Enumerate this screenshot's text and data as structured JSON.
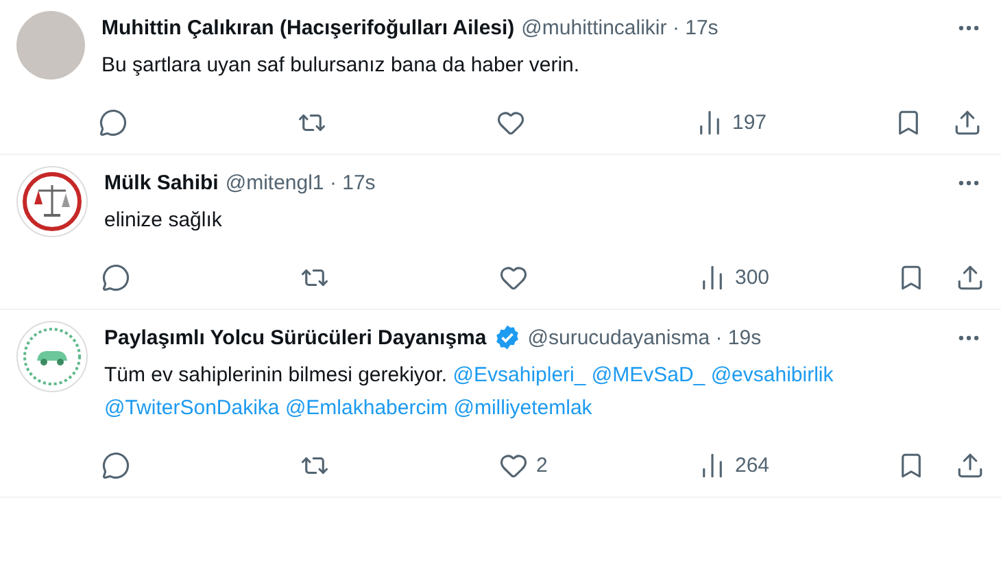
{
  "tweets": [
    {
      "author": {
        "name": "Muhittin Çalıkıran (Hacışerifoğulları Ailesi)",
        "handle": "@muhittincalikir",
        "verified": false,
        "avatar": {
          "kind": "photo"
        }
      },
      "separator": "·",
      "time": "17s",
      "body": [
        {
          "kind": "text",
          "text": "Bu şartlara uyan saf bulursanız bana da haber verin."
        }
      ],
      "actions": [
        {
          "kind": "reply"
        },
        {
          "kind": "retweet"
        },
        {
          "kind": "like"
        },
        {
          "kind": "views",
          "count": "197"
        },
        {
          "kind": "bookmark"
        },
        {
          "kind": "share"
        }
      ]
    },
    {
      "author": {
        "name": "Mülk Sahibi",
        "handle": "@mitengl1",
        "verified": false,
        "avatar": {
          "kind": "scale"
        }
      },
      "separator": "·",
      "time": "17s",
      "body": [
        {
          "kind": "text",
          "text": "elinize sağlık"
        }
      ],
      "actions": [
        {
          "kind": "reply"
        },
        {
          "kind": "retweet"
        },
        {
          "kind": "like"
        },
        {
          "kind": "views",
          "count": "300"
        },
        {
          "kind": "bookmark"
        },
        {
          "kind": "share"
        }
      ]
    },
    {
      "author": {
        "name": "Paylaşımlı Yolcu Sürücüleri Dayanışma",
        "handle": "@surucudayanisma",
        "verified": true,
        "avatar": {
          "kind": "car"
        }
      },
      "separator": "·",
      "time": "19s",
      "body": [
        {
          "kind": "text",
          "text": "Tüm ev sahiplerinin bilmesi gerekiyor."
        },
        {
          "kind": "mention",
          "text": "@Evsahipleri_"
        },
        {
          "kind": "mention",
          "text": "@MEvSaD_"
        },
        {
          "kind": "mention",
          "text": "@evsahibirlik"
        },
        {
          "kind": "mention",
          "text": "@TwiterSonDakika"
        },
        {
          "kind": "mention",
          "text": "@Emlakhabercim"
        },
        {
          "kind": "mention",
          "text": "@milliyetemlak"
        }
      ],
      "actions": [
        {
          "kind": "reply"
        },
        {
          "kind": "retweet"
        },
        {
          "kind": "like",
          "count": "2"
        },
        {
          "kind": "views",
          "count": "264"
        },
        {
          "kind": "bookmark"
        },
        {
          "kind": "share"
        }
      ]
    }
  ]
}
